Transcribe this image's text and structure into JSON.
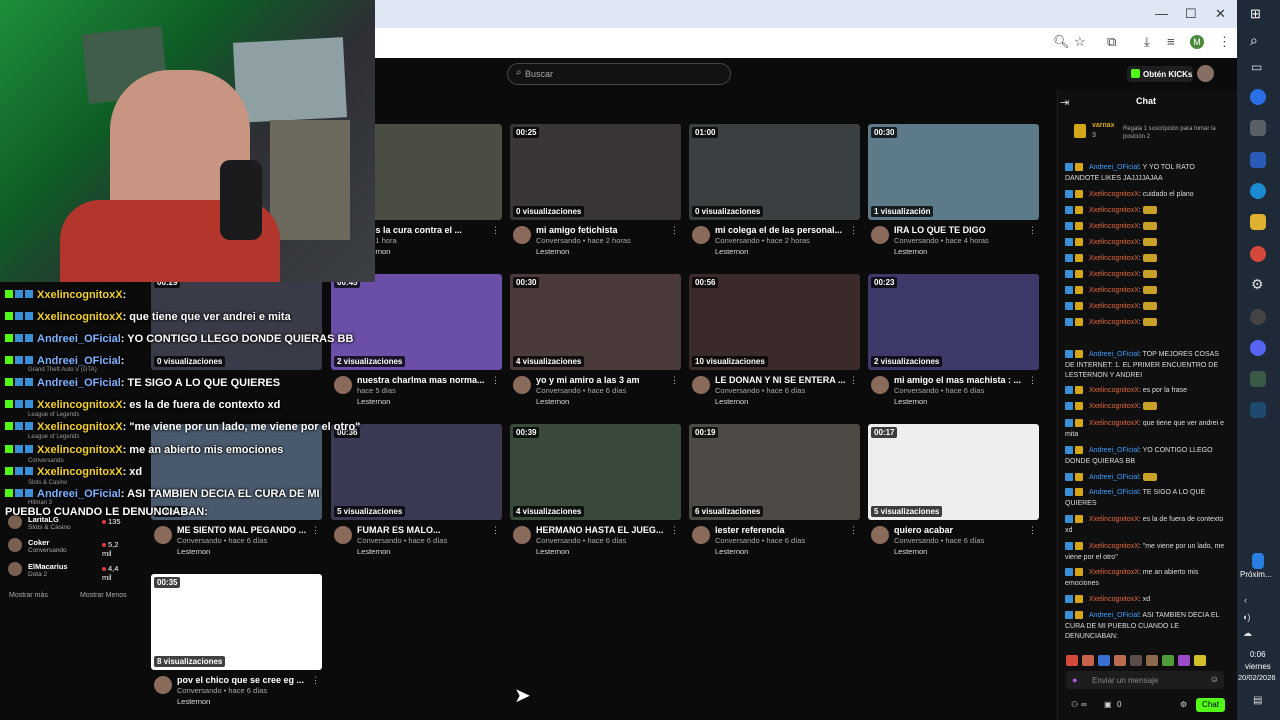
{
  "browser": {
    "window_controls": [
      "—",
      "☐",
      "✕"
    ],
    "toolbar_icons": [
      "zoom-icon",
      "star-icon",
      "extensions-icon",
      "download-icon",
      "queue-icon"
    ],
    "profile_initial": "M"
  },
  "kick": {
    "search_placeholder": "Buscar",
    "kicks_button": "Obtén KICKs"
  },
  "videos": [
    {
      "duration": "",
      "views": "…ciones",
      "title": "tenes la cura contra el ...",
      "category": "",
      "time": "hace 1 hora",
      "channel": "Lesternon"
    },
    {
      "duration": "00:25",
      "views": "0 visualizaciones",
      "title": "mi amigo fetichista",
      "category": "Conversando",
      "time": "hace 2 horas",
      "channel": "Lesternon"
    },
    {
      "duration": "01:00",
      "views": "0 visualizaciones",
      "title": "mi colega el de las personal...",
      "category": "Conversando",
      "time": "hace 2 horas",
      "channel": "Lesternon"
    },
    {
      "duration": "00:30",
      "views": "1 visualización",
      "title": "IRA LO QUE TE DIGO",
      "category": "Conversando",
      "time": "hace 4 horas",
      "channel": "Lesternon"
    },
    {
      "duration": "00:29",
      "views": "0 visualizaciones",
      "title": "",
      "category": "",
      "time": "",
      "channel": ""
    },
    {
      "duration": "00:45",
      "views": "2 visualizaciones",
      "title": "nuestra charlma mas norma...",
      "category": "",
      "time": "hace 5 días",
      "channel": "Lesternon"
    },
    {
      "duration": "00:30",
      "views": "4 visualizaciones",
      "title": "yo y mi amiro a las 3 am",
      "category": "Conversando",
      "time": "hace 6 días",
      "channel": "Lesternon"
    },
    {
      "duration": "00:56",
      "views": "10 visualizaciones",
      "title": "LE DONAN Y NI SE ENTERA ...",
      "category": "Conversando",
      "time": "hace 6 días",
      "channel": "Lesternon"
    },
    {
      "duration": "00:23",
      "views": "2 visualizaciones",
      "title": "mi amigo el mas machista : ...",
      "category": "Conversando",
      "time": "hace 6 días",
      "channel": "Lesternon"
    },
    {
      "duration": "",
      "views": "…nes",
      "title": "ME SIENTO MAL PEGANDO ...",
      "category": "Conversando",
      "time": "hace 6 días",
      "channel": "Lesternon"
    },
    {
      "duration": "00:36",
      "views": "5 visualizaciones",
      "title": "FUMAR ES MALO...",
      "category": "Conversando",
      "time": "hace 6 días",
      "channel": "Lesternon"
    },
    {
      "duration": "00:39",
      "views": "4 visualizaciones",
      "title": "HERMANO HASTA EL JUEG...",
      "category": "Conversando",
      "time": "hace 6 días",
      "channel": "Lesternon"
    },
    {
      "duration": "00:19",
      "views": "6 visualizaciones",
      "title": "lester referencia",
      "category": "Conversando",
      "time": "hace 6 días",
      "channel": "Lesternon"
    },
    {
      "duration": "00:17",
      "views": "5 visualizaciones",
      "title": "quiero acabar",
      "category": "Conversando",
      "time": "hace 6 días",
      "channel": "Lesternon"
    },
    {
      "duration": "00:35",
      "views": "8 visualizaciones",
      "title": "pov el chico que se cree eg ...",
      "category": "Conversando",
      "time": "hace 6 días",
      "channel": "Lesternon"
    }
  ],
  "chat": {
    "title": "Chat",
    "top_user": "varnax",
    "top_amount": "3",
    "gift_text": "Regala 1 suscripción para tomar la posición 2",
    "messages": [
      {
        "user": "Andreei_OFicial",
        "text": "Y YO TOL RATO DANDOTE LIKES JAJJJJAJAA",
        "color": "u1"
      },
      {
        "user": "XxelincognitoxX",
        "text": "cuidado el plano",
        "color": "u2"
      },
      {
        "user": "XxelincognitoxX",
        "text": "",
        "color": "u2"
      },
      {
        "user": "XxelincognitoxX",
        "text": "",
        "color": "u2"
      },
      {
        "user": "XxelincognitoxX",
        "text": "",
        "color": "u2"
      },
      {
        "user": "XxelincognitoxX",
        "text": "",
        "color": "u2"
      },
      {
        "user": "XxelincognitoxX",
        "text": "",
        "color": "u2"
      },
      {
        "user": "XxelincognitoxX",
        "text": "",
        "color": "u2"
      },
      {
        "user": "XxelincognitoxX",
        "text": "",
        "color": "u2"
      },
      {
        "user": "XxelincognitoxX",
        "text": "",
        "color": "u2"
      },
      {
        "user": "Andreei_OFicial",
        "text": "TOP MEJORES COSAS DE INTERNET: 1. EL PRIMER ENCUENTRO DE LESTERNON Y ANDREI",
        "color": "u1"
      },
      {
        "user": "XxelincognitoxX",
        "text": "es por la frase",
        "color": "u2"
      },
      {
        "user": "XxelincognitoxX",
        "text": "",
        "color": "u2"
      },
      {
        "user": "XxelincognitoxX",
        "text": "que tiene que ver andrei e mita",
        "color": "u2"
      },
      {
        "user": "Andreei_OFicial",
        "text": "YO CONTIGO LLEGO DONDE QUIERAS BB",
        "color": "u1"
      },
      {
        "user": "Andreei_OFicial",
        "text": "",
        "color": "u1"
      },
      {
        "user": "Andreei_OFicial",
        "text": "TE SIGO A LO QUE QUIERES",
        "color": "u1"
      },
      {
        "user": "XxelincognitoxX",
        "text": "es la de fuera de contexto xd",
        "color": "u2"
      },
      {
        "user": "XxelincognitoxX",
        "text": "\"me viene por un lado, me viene por el otro\"",
        "color": "u2"
      },
      {
        "user": "XxelincognitoxX",
        "text": "me an abierto mis emociones",
        "color": "u2"
      },
      {
        "user": "XxelincognitoxX",
        "text": "xd",
        "color": "u2"
      },
      {
        "user": "Andreei_OFicial",
        "text": "ASI TAMBIEN DECIA EL CURA DE MI PUEBLO CUANDO LE DENUNCIABAN:",
        "color": "u1"
      }
    ],
    "input_placeholder": "Enviar un mensaje",
    "viewers_icon": "∞",
    "count_value": "0",
    "send_label": "Chat"
  },
  "overlay": {
    "lines": [
      {
        "user": "XxelincognitoxX",
        "text": ":"
      },
      {
        "user": "XxelincognitoxX",
        "text": ": que tiene que ver andrei e mita"
      },
      {
        "user": "Andreei_OFicial",
        "text": ": YO CONTIGO LLEGO DONDE QUIERAS BB"
      },
      {
        "user": "Andreei_OFicial",
        "text": ":"
      },
      {
        "user": "Andreei_OFicial",
        "text": ": TE SIGO A LO QUE QUIERES"
      },
      {
        "user": "XxelincognitoxX",
        "text": ": es la de fuera de contexto xd"
      },
      {
        "user": "XxelincognitoxX",
        "text": ": \"me viene por un lado, me viene por el otro\""
      },
      {
        "user": "XxelincognitoxX",
        "text": ": me an abierto mis emociones"
      },
      {
        "user": "XxelincognitoxX",
        "text": ": xd"
      },
      {
        "user": "Andreei_OFicial",
        "text": ": ASI TAMBIEN DECIA EL CURA DE MI"
      }
    ],
    "wrap_line": "PUEBLO CUANDO LE DENUNCIABAN:"
  },
  "sidebar": {
    "channels": [
      {
        "name": "LaritaLG",
        "category": "Slots & Casino",
        "viewers": "135"
      },
      {
        "name": "Coker",
        "category": "Conversando",
        "viewers": "5,2 mil"
      },
      {
        "name": "ElMacarius",
        "category": "Dota 2",
        "viewers": "4,4 mil"
      }
    ],
    "hidden_categories": [
      "Grand Theft Auto V (GTA)",
      "League of Legends",
      "League of Legends",
      "Conversando",
      "Slots & Casino",
      "Hitman 3"
    ],
    "show_more": "Mostrar más",
    "show_less": "Mostrar Menos"
  },
  "taskbar": {
    "time": "0:06",
    "day": "viernes",
    "date": "20/02/2026",
    "next_label": "Próxim..."
  },
  "colors": {
    "kick_green": "#53fc18",
    "background": "#0b0b0c",
    "chat_user_blue": "#3b9cff",
    "chat_user_orange": "#e8683a"
  }
}
